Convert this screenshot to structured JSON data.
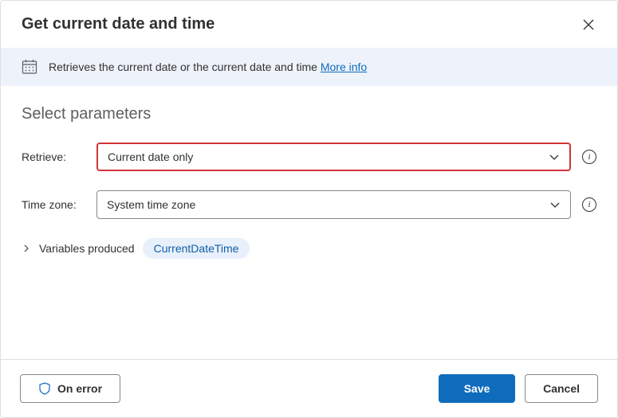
{
  "header": {
    "title": "Get current date and time"
  },
  "infobar": {
    "text": "Retrieves the current date or the current date and time ",
    "more_link": "More info"
  },
  "section_title": "Select parameters",
  "fields": {
    "retrieve": {
      "label": "Retrieve:",
      "value": "Current date only"
    },
    "timezone": {
      "label": "Time zone:",
      "value": "System time zone"
    }
  },
  "variables": {
    "label": "Variables produced",
    "chip": "CurrentDateTime"
  },
  "footer": {
    "on_error": "On error",
    "save": "Save",
    "cancel": "Cancel"
  }
}
